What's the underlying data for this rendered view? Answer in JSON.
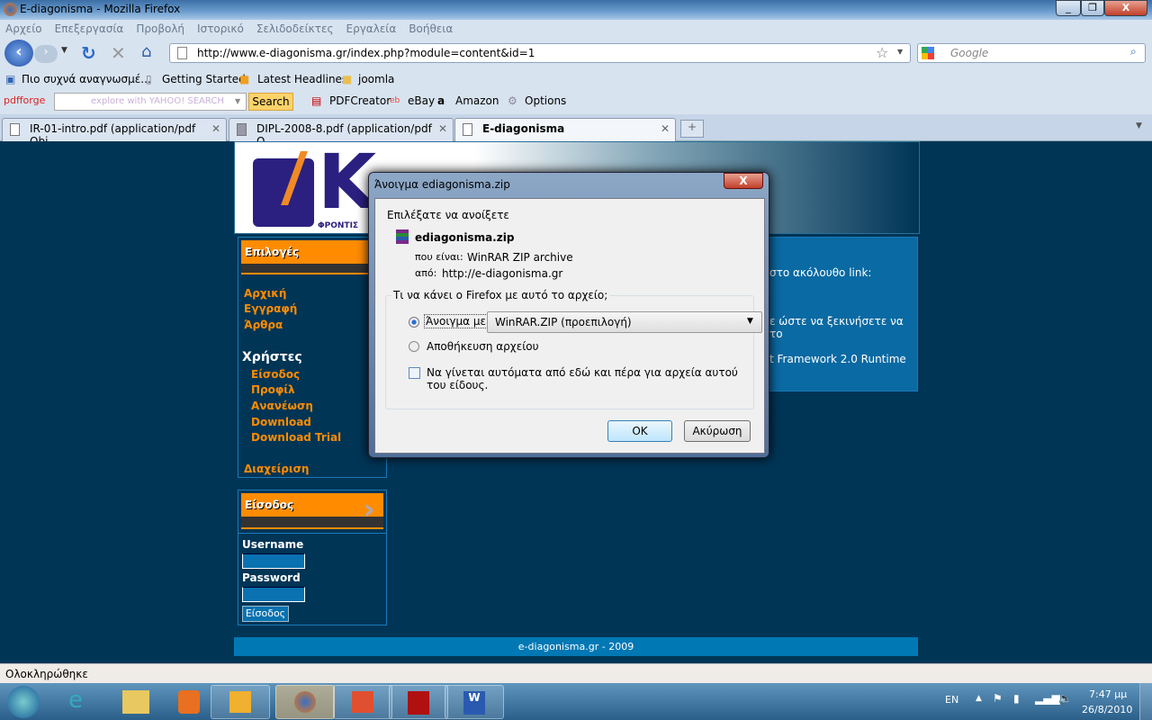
{
  "window": {
    "title": "E-diagonisma - Mozilla Firefox",
    "minimize": "_",
    "maximize": "❐",
    "close": "X"
  },
  "menu": [
    "Αρχείο",
    "Επεξεργασία",
    "Προβολή",
    "Ιστορικό",
    "Σελιδοδείκτες",
    "Εργαλεία",
    "Βοήθεια"
  ],
  "nav": {
    "url": "http://www.e-diagonisma.gr/index.php?module=content&id=1",
    "search_placeholder": "Google"
  },
  "bookmarks": [
    "Πιο συχνά αναγνωσμέ...",
    "Getting Started",
    "Latest Headlines",
    "joomla"
  ],
  "toolbar": {
    "brand": "pdfforge",
    "search_placeholder": "explore with YAHOO! SEARCH",
    "search_button": "Search",
    "items": [
      "PDFCreator",
      "eBay",
      "Amazon",
      "Options"
    ]
  },
  "tabs": [
    {
      "label": "IR-01-intro.pdf (application/pdf Obj..."
    },
    {
      "label": "DIPL-2008-8.pdf (application/pdf O..."
    },
    {
      "label": "E-diagonisma"
    }
  ],
  "page": {
    "logo_text": "Κ",
    "logo_sub": "ΦΡΟΝΤΙΣ",
    "options_header": "Επιλογές",
    "links": [
      "Αρχική",
      "Εγγραφή",
      "Άρθρα"
    ],
    "users_header": "Χρήστες",
    "user_links": [
      "Είσοδος",
      "Προφίλ",
      "Ανανέωση",
      "Download",
      "Download Trial"
    ],
    "admin": "Διαχείριση",
    "login_header": "Είσοδος",
    "username_label": "Username",
    "password_label": "Password",
    "login_button": "Είσοδος",
    "content_lines": [
      "στο ακόλουθο link:",
      "ε ώστε να ξεκινήσετε να το",
      "t Framework 2.0 Runtime"
    ],
    "footer": "e-diagonisma.gr - 2009"
  },
  "dialog": {
    "title": "Άνοιγμα ediagonisma.zip",
    "intro": "Επιλέξατε να ανοίξετε",
    "filename": "ediagonisma.zip",
    "type_label": "που είναι:",
    "type_value": "WinRAR ZIP archive",
    "from_label": "από:",
    "from_value": "http://e-diagonisma.gr",
    "group_label": "Τι να κάνει ο Firefox  με αυτό το αρχείο;",
    "open_with_label": "Άνοιγμα με",
    "open_with_value": "WinRAR.ZIP (προεπιλογή)",
    "open_with_selected": true,
    "save_label": "Αποθήκευση αρχείου",
    "auto_label": "Να γίνεται αυτόματα από εδώ και πέρα για αρχεία αυτού του είδους.",
    "auto_checked": false,
    "ok": "OK",
    "cancel": "Ακύρωση"
  },
  "status": "Ολοκληρώθηκε",
  "tray": {
    "lang": "EN",
    "time": "7:47 μμ",
    "date": "26/8/2010"
  }
}
